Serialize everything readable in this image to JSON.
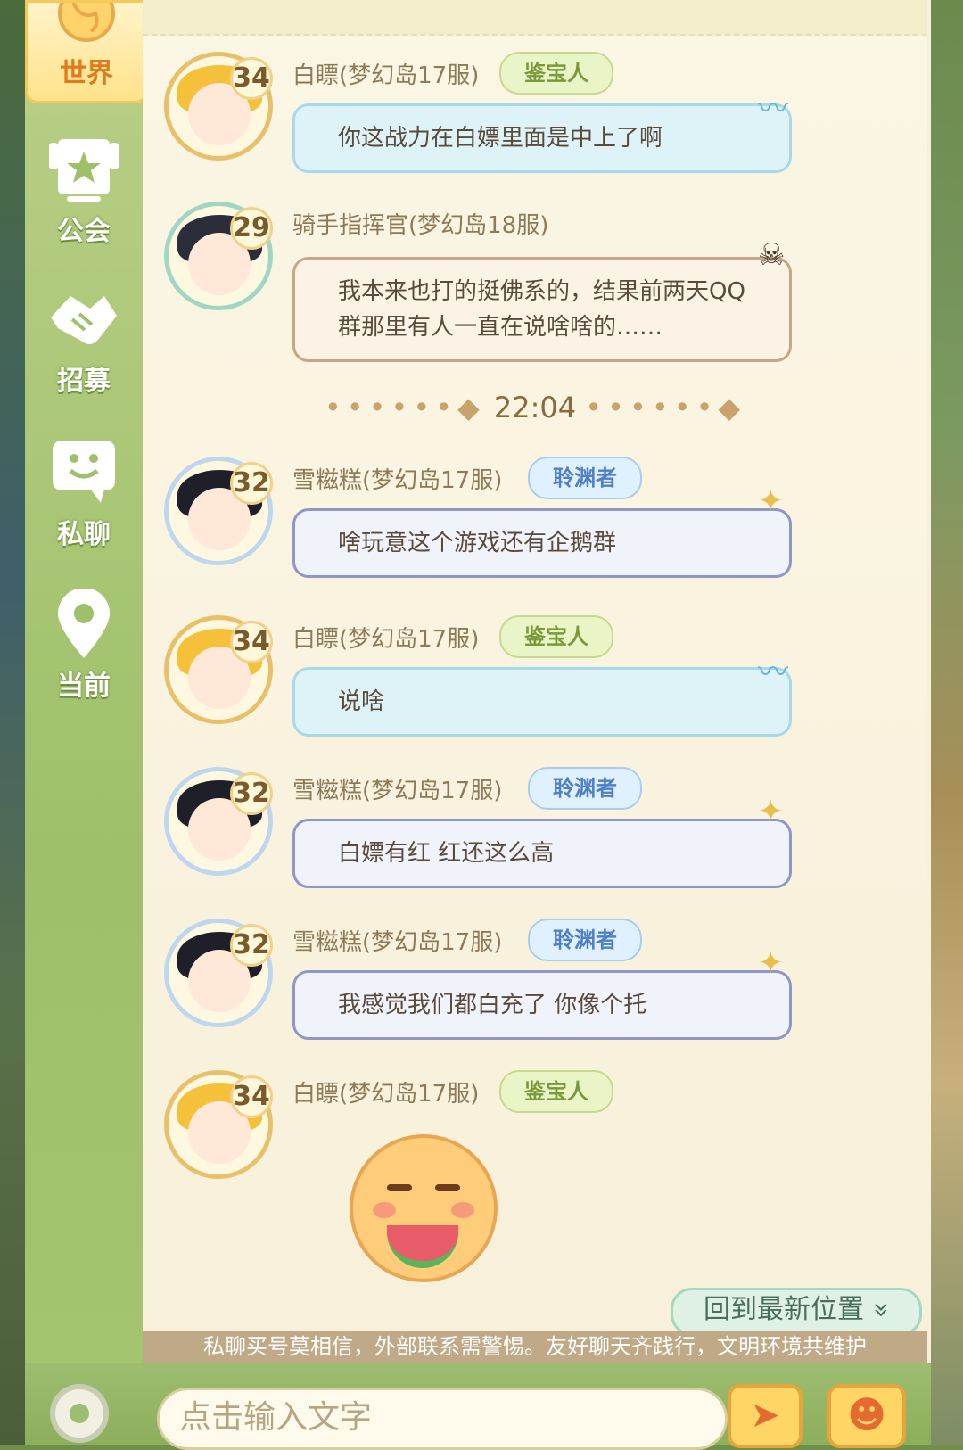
{
  "sidebar": {
    "tabs": [
      {
        "label": "世界",
        "icon": "globe-icon",
        "active": true
      },
      {
        "label": "公会",
        "icon": "guild-flag-icon"
      },
      {
        "label": "招募",
        "icon": "handshake-icon"
      },
      {
        "label": "私聊",
        "icon": "chat-face-icon"
      },
      {
        "label": "当前",
        "icon": "location-pin-icon"
      }
    ]
  },
  "chat": {
    "messages": [
      {
        "level": "34",
        "name": "白瞟(梦幻岛17服)",
        "badge": "鉴宝人",
        "text": "你这战力在白嫖里面是中上了啊"
      },
      {
        "level": "29",
        "name": "骑手指挥官(梦幻岛18服)",
        "badge": "",
        "text": "我本来也打的挺佛系的，结果前两天QQ群那里有人一直在说啥啥的……"
      },
      {
        "level": "32",
        "name": "雪糍糕(梦幻岛17服)",
        "badge": "聆渊者",
        "text": "啥玩意这个游戏还有企鹅群"
      },
      {
        "level": "34",
        "name": "白瞟(梦幻岛17服)",
        "badge": "鉴宝人",
        "text": "说啥"
      },
      {
        "level": "32",
        "name": "雪糍糕(梦幻岛17服)",
        "badge": "聆渊者",
        "text": "白嫖有红 红还这么高"
      },
      {
        "level": "32",
        "name": "雪糍糕(梦幻岛17服)",
        "badge": "聆渊者",
        "text": "我感觉我们都白充了 你像个托"
      },
      {
        "level": "34",
        "name": "白瞟(梦幻岛17服)",
        "badge": "鉴宝人",
        "text": ""
      }
    ],
    "timestamp": "22:04",
    "timeline_dots": "••••••◆"
  },
  "jump_button": "回到最新位置",
  "jump_icon": "»",
  "warning": "私聊买号莫相信，外部联系需警惕。友好聊天齐践行，文明环境共维护",
  "input": {
    "placeholder": "点击输入文字"
  },
  "buttons": {
    "send_icon": "➤",
    "emoji_icon": "☻"
  },
  "colors": {
    "accent": "#e07a1c",
    "sidebar": "#9ec06a",
    "panel": "#f6f0dc"
  }
}
